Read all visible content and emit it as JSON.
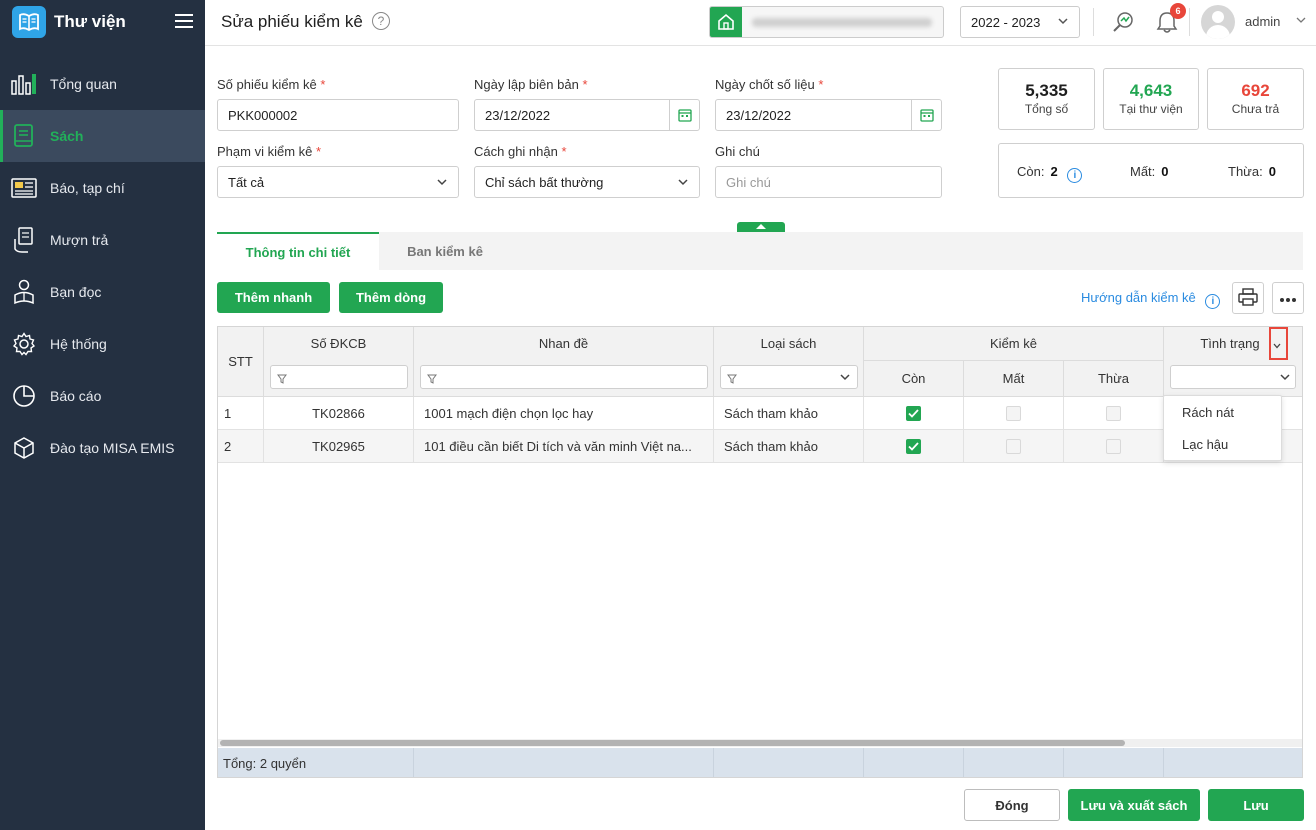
{
  "app": {
    "title": "Thư viện"
  },
  "sidebar": {
    "items": [
      {
        "label": "Tổng quan",
        "icon": "chart-bars-icon"
      },
      {
        "label": "Sách",
        "icon": "book-icon",
        "active": true
      },
      {
        "label": "Báo, tạp chí",
        "icon": "newspaper-icon"
      },
      {
        "label": "Mượn trả",
        "icon": "hand-book-icon"
      },
      {
        "label": "Bạn đọc",
        "icon": "reader-icon"
      },
      {
        "label": "Hệ thống",
        "icon": "gear-icon"
      },
      {
        "label": "Báo cáo",
        "icon": "pie-chart-icon"
      },
      {
        "label": "Đào tạo MISA EMIS",
        "icon": "cube-icon"
      }
    ]
  },
  "header": {
    "title": "Sửa phiếu kiểm kê",
    "school_year": "2022 - 2023",
    "notification_count": "6",
    "username": "admin"
  },
  "form": {
    "ticket_no_label": "Số phiếu kiểm kê",
    "ticket_no_value": "PKK000002",
    "created_date_label": "Ngày lập biên bản",
    "created_date_value": "23/12/2022",
    "cutoff_date_label": "Ngày chốt số liệu",
    "cutoff_date_value": "23/12/2022",
    "scope_label": "Phạm vi kiểm kê",
    "scope_value": "Tất cả",
    "record_mode_label": "Cách ghi nhận",
    "record_mode_value": "Chỉ sách bất thường",
    "note_label": "Ghi chú",
    "note_placeholder": "Ghi chú",
    "required_mark": "*"
  },
  "stats": {
    "total": {
      "value": "5,335",
      "label": "Tổng số",
      "color": "#1f1f1f"
    },
    "in_library": {
      "value": "4,643",
      "label": "Tại thư viện",
      "color": "#22a652"
    },
    "not_returned": {
      "value": "692",
      "label": "Chưa trả",
      "color": "#e8463a"
    }
  },
  "summary": {
    "remaining_label": "Còn:",
    "remaining_value": "2",
    "lost_label": "Mất:",
    "lost_value": "0",
    "excess_label": "Thừa:",
    "excess_value": "0"
  },
  "tabs": [
    {
      "label": "Thông tin chi tiết",
      "active": true
    },
    {
      "label": "Ban kiểm kê",
      "active": false
    }
  ],
  "toolbar": {
    "quick_add": "Thêm nhanh",
    "add_row": "Thêm dòng",
    "guide_link": "Hướng dẫn kiểm kê"
  },
  "table": {
    "columns": {
      "stt": "STT",
      "reg_no": "Số ĐKCB",
      "title": "Nhan đề",
      "book_type": "Loại sách",
      "inventory": "Kiểm kê",
      "remaining": "Còn",
      "lost": "Mất",
      "excess": "Thừa",
      "condition": "Tình trạng"
    },
    "rows": [
      {
        "stt": "1",
        "reg_no": "TK02866",
        "title": "1001 mạch điện chọn lọc hay",
        "book_type": "Sách tham khảo",
        "remaining": true,
        "lost": false,
        "excess": false
      },
      {
        "stt": "2",
        "reg_no": "TK02965",
        "title": "101 điều cần biết Di tích và văn minh Việt na...",
        "book_type": "Sách tham khảo",
        "remaining": true,
        "lost": false,
        "excess": false
      }
    ],
    "footer": "Tổng: 2 quyển"
  },
  "condition_dropdown": {
    "options": [
      "Rách nát",
      "Lạc hậu"
    ]
  },
  "actions": {
    "close": "Đóng",
    "save_export": "Lưu và xuất sách",
    "save": "Lưu"
  },
  "colors": {
    "accent": "#22a652",
    "sidebar": "#243041",
    "link": "#2a8be0",
    "danger": "#e8463a"
  }
}
